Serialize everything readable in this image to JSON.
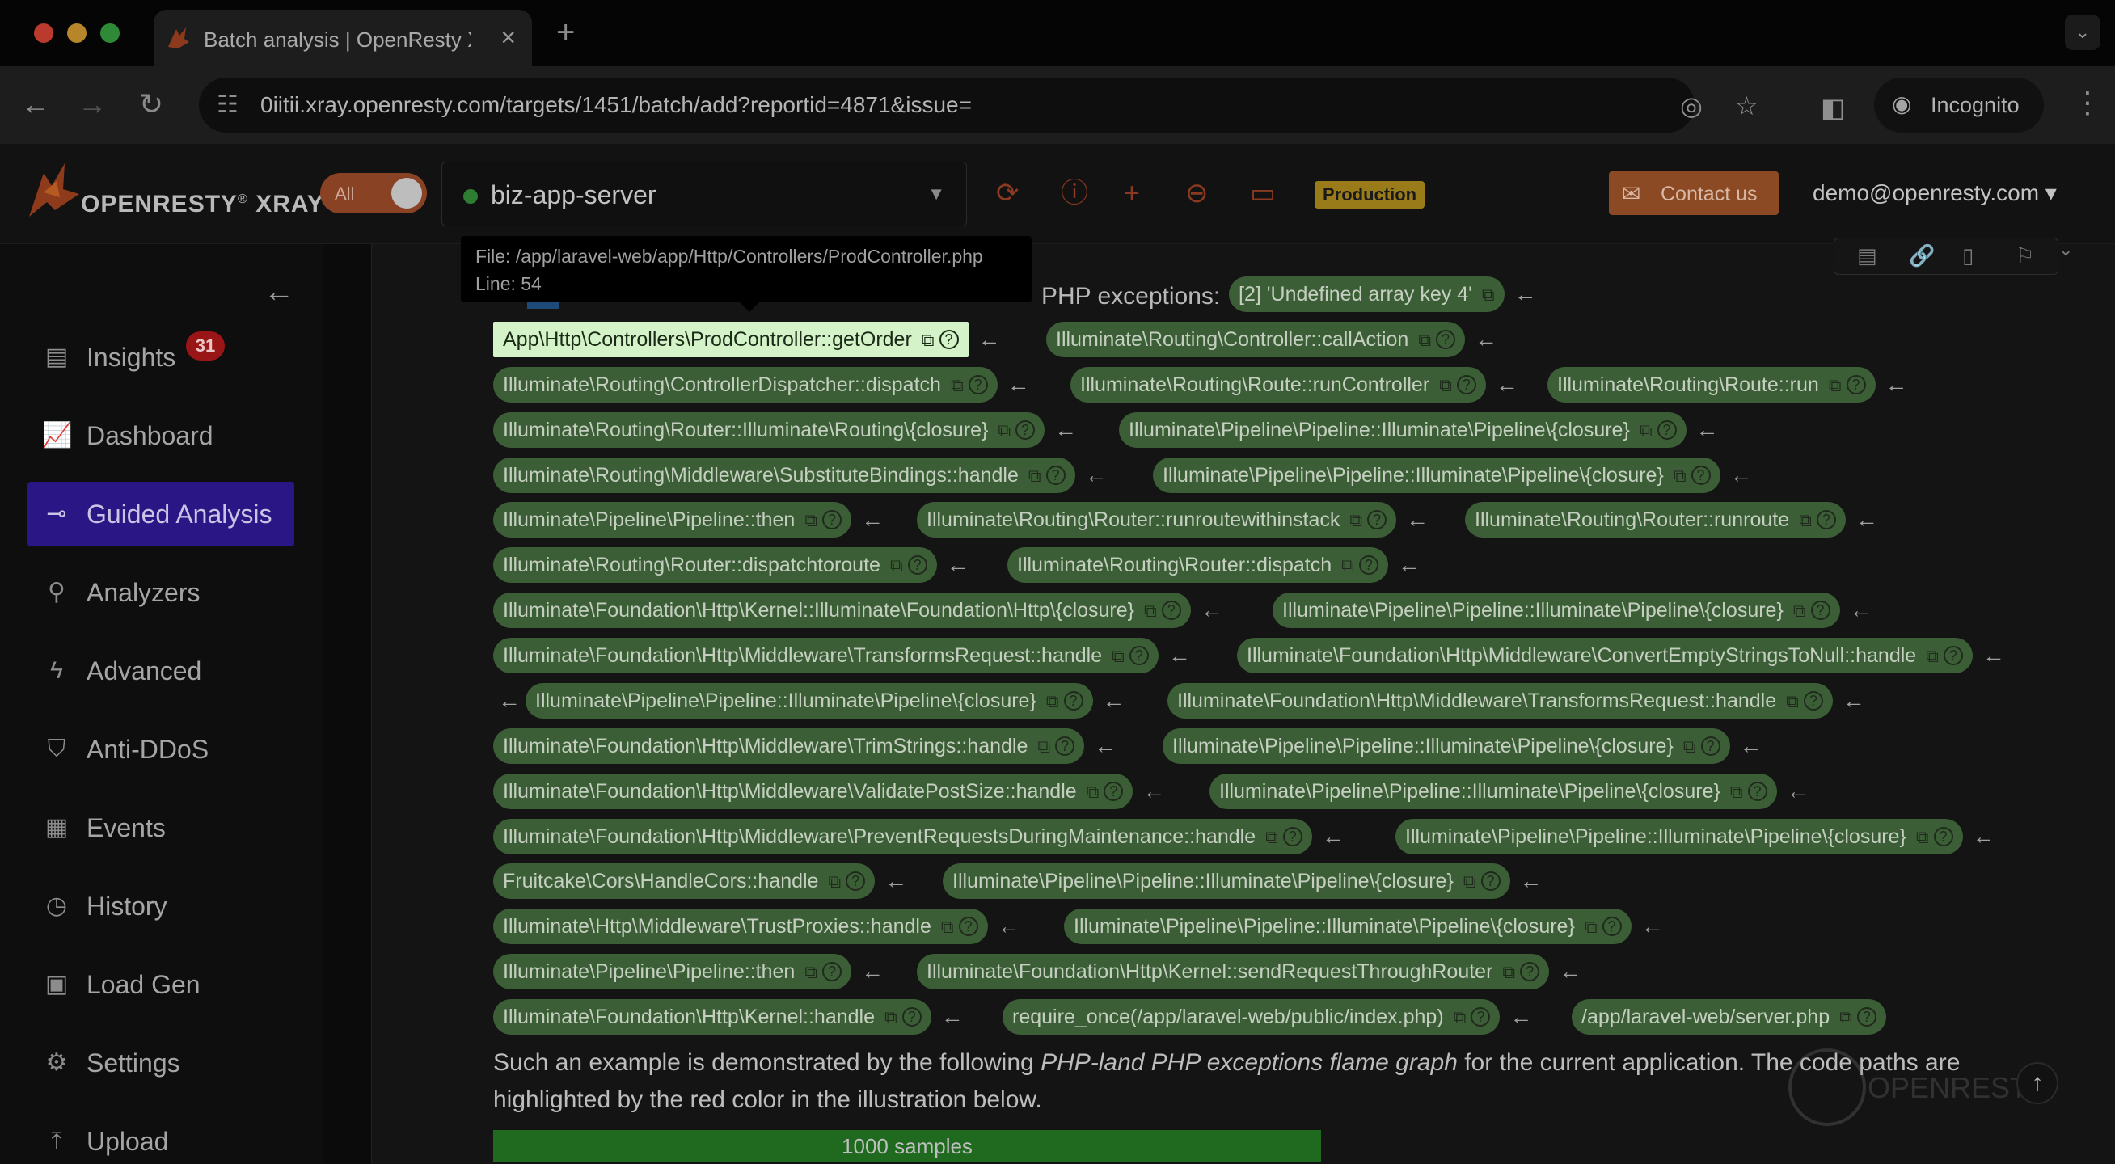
{
  "browser": {
    "tab_title": "Batch analysis | OpenResty X",
    "url": "0iitii.xray.openresty.com/targets/1451/batch/add?reportid=4871&issue=",
    "incognito_label": "Incognito"
  },
  "header": {
    "logo_text": "OPENRESTY",
    "logo_reg": "®",
    "logo_product": "XRAY",
    "toggle_label": "All",
    "target_name": "biz-app-server",
    "env_badge": "Production",
    "contact_label": "Contact us",
    "user_email": "demo@openresty.com ▾"
  },
  "sidebar": {
    "items": [
      {
        "label": "Insights",
        "icon": "insights-icon",
        "badge": "31"
      },
      {
        "label": "Dashboard",
        "icon": "dashboard-icon"
      },
      {
        "label": "Guided Analysis",
        "icon": "guided-analysis-icon",
        "active": true
      },
      {
        "label": "Analyzers",
        "icon": "analyzers-icon"
      },
      {
        "label": "Advanced",
        "icon": "advanced-icon"
      },
      {
        "label": "Anti-DDoS",
        "icon": "anti-ddos-icon"
      },
      {
        "label": "Events",
        "icon": "events-icon"
      },
      {
        "label": "History",
        "icon": "history-icon"
      },
      {
        "label": "Load Gen",
        "icon": "load-gen-icon"
      },
      {
        "label": "Settings",
        "icon": "settings-icon"
      },
      {
        "label": "Upload",
        "icon": "upload-icon"
      }
    ]
  },
  "tooltip": {
    "file": "File: /app/laravel-web/app/Http/Controllers/ProdController.php",
    "line": "Line: 54"
  },
  "intro_text": "PHP exceptions:",
  "stack": {
    "first_chip": "[2] 'Undefined array key 4'",
    "frames": [
      "App\\Http\\Controllers\\ProdController::getOrder",
      "Illuminate\\Routing\\Controller::callAction",
      "Illuminate\\Routing\\ControllerDispatcher::dispatch",
      "Illuminate\\Routing\\Route::runController",
      "Illuminate\\Routing\\Route::run",
      "Illuminate\\Routing\\Router::Illuminate\\Routing\\{closure}",
      "Illuminate\\Pipeline\\Pipeline::Illuminate\\Pipeline\\{closure}",
      "Illuminate\\Routing\\Middleware\\SubstituteBindings::handle",
      "Illuminate\\Pipeline\\Pipeline::Illuminate\\Pipeline\\{closure}",
      "Illuminate\\Pipeline\\Pipeline::then",
      "Illuminate\\Routing\\Router::runroutewithinstack",
      "Illuminate\\Routing\\Router::runroute",
      "Illuminate\\Routing\\Router::dispatchtoroute",
      "Illuminate\\Routing\\Router::dispatch",
      "Illuminate\\Foundation\\Http\\Kernel::Illuminate\\Foundation\\Http\\{closure}",
      "Illuminate\\Pipeline\\Pipeline::Illuminate\\Pipeline\\{closure}",
      "Illuminate\\Foundation\\Http\\Middleware\\TransformsRequest::handle",
      "Illuminate\\Foundation\\Http\\Middleware\\ConvertEmptyStringsToNull::handle",
      "Illuminate\\Pipeline\\Pipeline::Illuminate\\Pipeline\\{closure}",
      "Illuminate\\Foundation\\Http\\Middleware\\TransformsRequest::handle",
      "Illuminate\\Foundation\\Http\\Middleware\\TrimStrings::handle",
      "Illuminate\\Pipeline\\Pipeline::Illuminate\\Pipeline\\{closure}",
      "Illuminate\\Foundation\\Http\\Middleware\\ValidatePostSize::handle",
      "Illuminate\\Pipeline\\Pipeline::Illuminate\\Pipeline\\{closure}",
      "Illuminate\\Foundation\\Http\\Middleware\\PreventRequestsDuringMaintenance::handle",
      "Illuminate\\Pipeline\\Pipeline::Illuminate\\Pipeline\\{closure}",
      "Fruitcake\\Cors\\HandleCors::handle",
      "Illuminate\\Pipeline\\Pipeline::Illuminate\\Pipeline\\{closure}",
      "Illuminate\\Http\\Middleware\\TrustProxies::handle",
      "Illuminate\\Pipeline\\Pipeline::Illuminate\\Pipeline\\{closure}",
      "Illuminate\\Pipeline\\Pipeline::then",
      "Illuminate\\Foundation\\Http\\Kernel::sendRequestThroughRouter",
      "Illuminate\\Foundation\\Http\\Kernel::handle",
      "require_once(/app/laravel-web/public/index.php)",
      "/app/laravel-web/server.php"
    ]
  },
  "paragraph": {
    "part1": "Such an example is demonstrated by the following ",
    "italic": "PHP-land PHP exceptions flame graph",
    "part2": " for the current application. The code paths are",
    "line2": "highlighted by the red color in the illustration below."
  },
  "samples_label": "1000 samples",
  "glyphs": {
    "arrow": "←",
    "copy": "⧉",
    "help": "?"
  },
  "colors": {
    "active_nav": "#2a1685",
    "chip": "#3c5e36",
    "chip_highlight": "#d4f3c8",
    "accent": "#8b4a24",
    "badge": "#9a1515"
  }
}
